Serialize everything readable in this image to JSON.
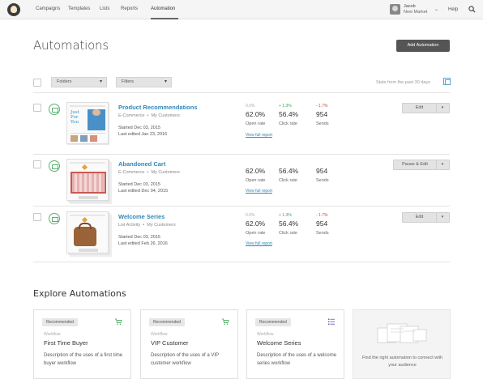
{
  "nav": {
    "items": [
      "Campaigns",
      "Templates",
      "Lists",
      "Reports",
      "Automation"
    ],
    "user_name": "Jacob",
    "user_org": "New Market",
    "help_label": "Help"
  },
  "header": {
    "title": "Automations",
    "add_button_label": "Add Automation"
  },
  "filters": {
    "folders_label": "Folders",
    "filters_label": "Filters",
    "stats_text": "Stats from the past 30 days"
  },
  "automations": [
    {
      "title": "Product Recommendations",
      "category": "E-Commerce",
      "list": "My Customers",
      "started": "Started Dec 03, 2015",
      "last_edited": "Last edited Jan 23, 2016",
      "open_change": "0.0%",
      "click_change": "+ 1.3%",
      "sends_change": "- 1.7%",
      "open_rate": "62.0%",
      "click_rate": "56.4%",
      "sends": "954",
      "open_label": "Open rate",
      "click_label": "Click rate",
      "sends_label": "Sends",
      "report_link": "View full report",
      "action_label": "Edit"
    },
    {
      "title": "Abandoned Cart",
      "category": "E-Commerce",
      "list": "My Customers",
      "started": "Started Dec 03, 2015",
      "last_edited": "Last edited Dec 04, 2015",
      "open_change": "",
      "click_change": "",
      "sends_change": "",
      "open_rate": "62.0%",
      "click_rate": "56.4%",
      "sends": "954",
      "open_label": "Open rate",
      "click_label": "Click rate",
      "sends_label": "Sends",
      "report_link": "View full report",
      "action_label": "Pause & Edit"
    },
    {
      "title": "Welcome Series",
      "category": "List Activity",
      "list": "My Customers",
      "started": "Started Dec 03, 2015",
      "last_edited": "Last edited Feb 26, 2016",
      "open_change": "0.0%",
      "click_change": "+ 1.3%",
      "sends_change": "- 1.7%",
      "open_rate": "62.0%",
      "click_rate": "56.4%",
      "sends": "954",
      "open_label": "Open rate",
      "click_label": "Click rate",
      "sends_label": "Sends",
      "report_link": "View full report",
      "action_label": "Edit"
    }
  ],
  "explore": {
    "title": "Explore Automations",
    "cards": [
      {
        "badge": "Recommended",
        "kicker": "Workflow",
        "name": "First Time Buyer",
        "description": "Description of the uses of a first time buyer workflow",
        "icon": "cart-icon"
      },
      {
        "badge": "Recommended",
        "kicker": "Workflow",
        "name": "VIP Customer",
        "description": "Description of the uses of a VIP customer workflow",
        "icon": "cart-icon"
      },
      {
        "badge": "Recommended",
        "kicker": "Workflow",
        "name": "Welcome Series",
        "description": "Description of the uses of a welcome series workflow",
        "icon": "list-icon"
      }
    ],
    "empty_card_text": "Find the right automation to connect with your audience"
  },
  "thumbnails": {
    "product_text": "Just For You"
  },
  "colors": {
    "link": "#2f88b5",
    "positive": "#3fa35a",
    "negative": "#d0453b",
    "status": "#5bb06f"
  }
}
